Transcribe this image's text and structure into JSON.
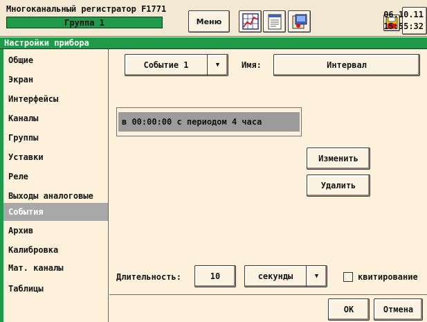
{
  "header": {
    "device_title": "Многоканальный регистратор F1771",
    "group_label": "Группа 1",
    "menu_label": "Меню",
    "date": "06.10.11",
    "time": "15:55:32",
    "icons": [
      "chart-icon",
      "notepad-icon",
      "archive-icon",
      "save-icon"
    ]
  },
  "window": {
    "title": "Настройки прибора"
  },
  "sidebar": {
    "items": [
      {
        "label": "Общие"
      },
      {
        "label": "Экран"
      },
      {
        "label": "Интерфейсы"
      },
      {
        "label": "Каналы"
      },
      {
        "label": "Группы"
      },
      {
        "label": "Уставки"
      },
      {
        "label": "Реле"
      },
      {
        "label": "Выходы аналоговые"
      },
      {
        "label": "События",
        "active": true
      },
      {
        "label": "Архив"
      },
      {
        "label": "Калибровка"
      },
      {
        "label": "Мат. каналы"
      },
      {
        "label": "Таблицы"
      }
    ]
  },
  "event": {
    "selector_value": "Событие 1",
    "name_label": "Имя:",
    "name_value": "Интервал",
    "list_items": [
      "в 00:00:00 с периодом 4 часа"
    ],
    "change_label": "Изменить",
    "delete_label": "Удалить",
    "duration_label": "Длительность:",
    "duration_value": "10",
    "duration_unit": "секунды",
    "ack_label": "квитирование",
    "ack_checked": false
  },
  "dialog": {
    "ok_label": "OK",
    "cancel_label": "Отмена"
  },
  "colors": {
    "accent_green": "#1f9a49",
    "background": "#fdf1dc",
    "selection_gray": "#a8a8a8"
  }
}
